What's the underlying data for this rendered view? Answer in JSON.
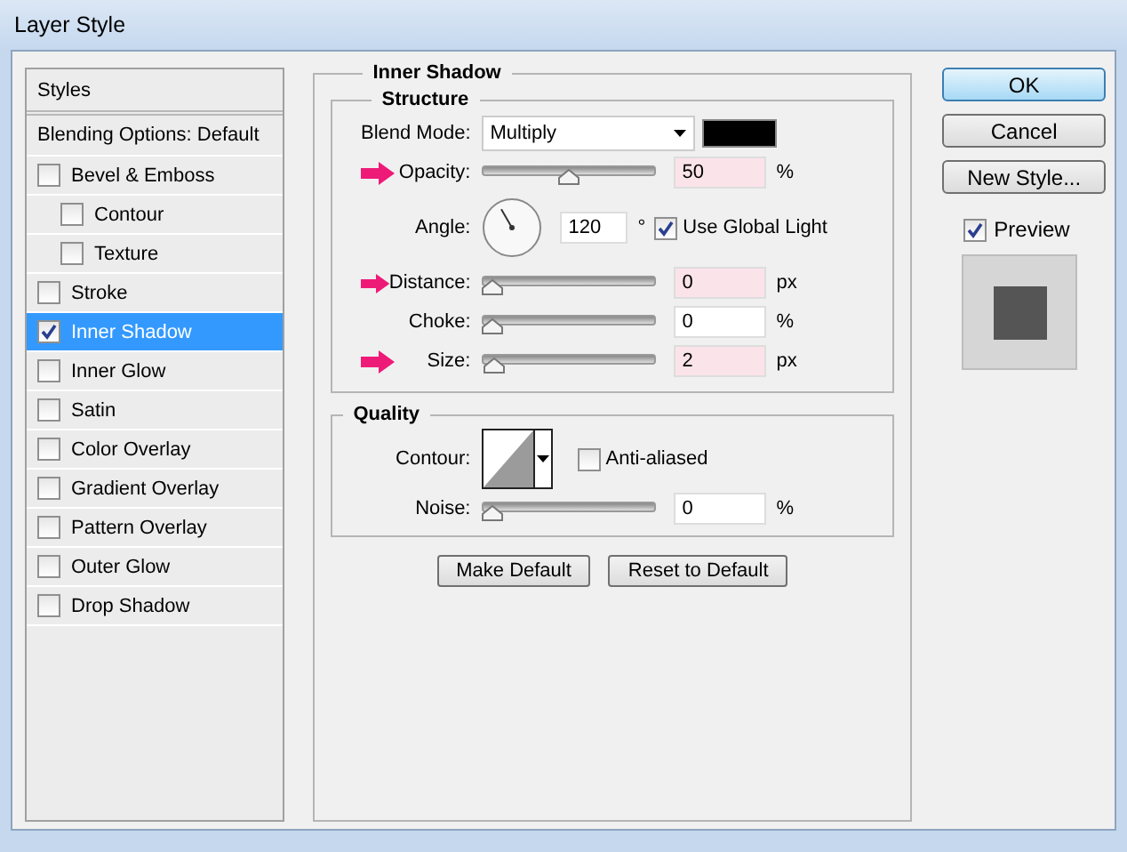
{
  "window": {
    "title": "Layer Style"
  },
  "styles": {
    "header": "Styles",
    "blending": "Blending Options: Default",
    "items": [
      {
        "label": "Bevel & Emboss",
        "checked": false,
        "selected": false,
        "children": [
          {
            "label": "Contour",
            "checked": false,
            "selected": false
          },
          {
            "label": "Texture",
            "checked": false,
            "selected": false
          }
        ]
      },
      {
        "label": "Stroke",
        "checked": false,
        "selected": false
      },
      {
        "label": "Inner Shadow",
        "checked": true,
        "selected": true
      },
      {
        "label": "Inner Glow",
        "checked": false,
        "selected": false
      },
      {
        "label": "Satin",
        "checked": false,
        "selected": false
      },
      {
        "label": "Color Overlay",
        "checked": false,
        "selected": false
      },
      {
        "label": "Gradient Overlay",
        "checked": false,
        "selected": false
      },
      {
        "label": "Pattern Overlay",
        "checked": false,
        "selected": false
      },
      {
        "label": "Outer Glow",
        "checked": false,
        "selected": false
      },
      {
        "label": "Drop Shadow",
        "checked": false,
        "selected": false
      }
    ]
  },
  "panel": {
    "title": "Inner Shadow",
    "structure": {
      "title": "Structure",
      "rows": [
        {
          "kind": "dropdown",
          "label": "Blend Mode:",
          "value": "Multiply",
          "color": "#000000",
          "highlighted": false
        },
        {
          "kind": "slider",
          "label": "Opacity:",
          "level": 0.5,
          "value": "50",
          "unit": "%",
          "highlighted": true
        },
        {
          "kind": "angle",
          "label": "Angle:",
          "value": "120",
          "unit": "°",
          "checkbox": {
            "label": "Use Global Light",
            "checked": true
          },
          "highlighted": false
        },
        {
          "kind": "slider",
          "label": "Distance:",
          "level": 0,
          "value": "0",
          "unit": "px",
          "highlighted": true
        },
        {
          "kind": "slider",
          "label": "Choke:",
          "level": 0,
          "value": "0",
          "unit": "%",
          "highlighted": false
        },
        {
          "kind": "slider",
          "label": "Size:",
          "level": 0.02,
          "value": "2",
          "unit": "px",
          "highlighted": true
        }
      ]
    },
    "quality": {
      "title": "Quality",
      "rows": [
        {
          "kind": "contour",
          "label": "Contour:",
          "checkbox": {
            "label": "Anti-aliased",
            "checked": false
          },
          "highlighted": false
        },
        {
          "kind": "slider",
          "label": "Noise:",
          "level": 0,
          "value": "0",
          "unit": "%",
          "highlighted": false
        }
      ]
    },
    "buttons": [
      "Make Default",
      "Reset to Default"
    ]
  },
  "actions": {
    "buttons": [
      {
        "label": "OK",
        "default": true
      },
      {
        "label": "Cancel",
        "default": false
      },
      {
        "label": "New Style...",
        "default": false
      }
    ],
    "preview": {
      "label": "Preview",
      "checked": true
    }
  }
}
